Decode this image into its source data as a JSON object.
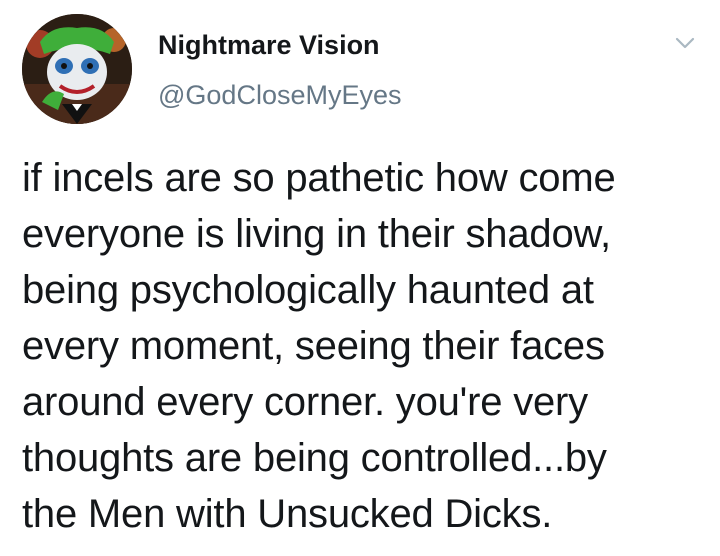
{
  "author": {
    "display_name": "Nightmare Vision",
    "handle": "@GodCloseMyEyes",
    "avatar_icon": "joker-pepe-avatar"
  },
  "menu": {
    "icon": "chevron-down-icon"
  },
  "tweet": {
    "text": "if incels are so pathetic how come\neveryone is living in their shadow,\nbeing psychologically haunted at\nevery moment, seeing their faces\naround every corner. you're very\nthoughts are being controlled...by\nthe Men with Unsucked Dicks."
  },
  "colors": {
    "text": "#14171a",
    "secondary": "#657786",
    "chevron": "#aab8c2"
  }
}
